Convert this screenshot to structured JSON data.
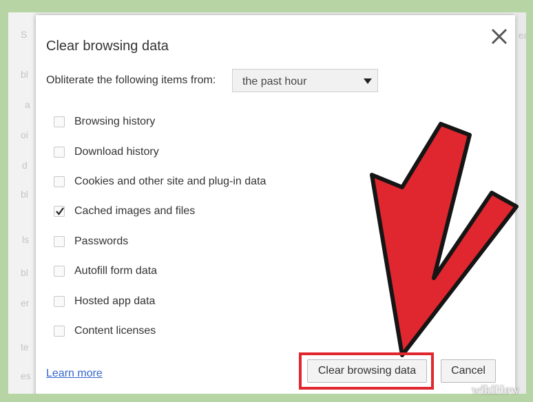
{
  "dialog": {
    "title": "Clear browsing data",
    "close_icon": "close-icon",
    "range_label": "Obliterate the following items from:",
    "range_value": "the past hour",
    "options": [
      {
        "label": "Browsing history",
        "checked": false
      },
      {
        "label": "Download history",
        "checked": false
      },
      {
        "label": "Cookies and other site and plug-in data",
        "checked": false
      },
      {
        "label": "Cached images and files",
        "checked": true
      },
      {
        "label": "Passwords",
        "checked": false
      },
      {
        "label": "Autofill form data",
        "checked": false
      },
      {
        "label": "Hosted app data",
        "checked": false
      },
      {
        "label": "Content licenses",
        "checked": false
      }
    ],
    "learn_more": "Learn more",
    "clear_button": "Clear browsing data",
    "cancel_button": "Cancel"
  },
  "background": {
    "search_text": "ea",
    "left_chars": [
      "S",
      "bl",
      "a",
      "oi",
      "d",
      "bl",
      "ls",
      "bl",
      "er",
      "te",
      "es"
    ]
  },
  "annotation": {
    "arrow_icon": "red-arrow-icon",
    "arrow_color": "#e0262e",
    "highlight_color": "#e0262e"
  },
  "watermark": "wikiHow"
}
